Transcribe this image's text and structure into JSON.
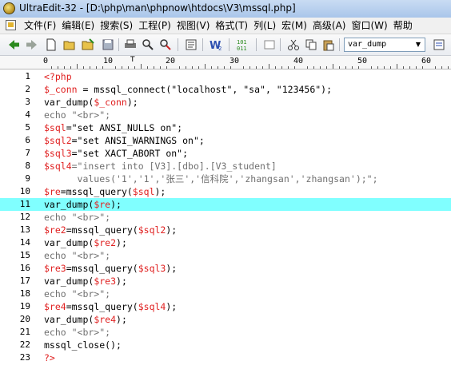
{
  "window": {
    "title": "UltraEdit-32 - [D:\\php\\man\\phpnow\\htdocs\\V3\\mssql.php]"
  },
  "menu": {
    "items": [
      {
        "label": "文件(F)"
      },
      {
        "label": "编辑(E)"
      },
      {
        "label": "搜索(S)"
      },
      {
        "label": "工程(P)"
      },
      {
        "label": "视图(V)"
      },
      {
        "label": "格式(T)"
      },
      {
        "label": "列(L)"
      },
      {
        "label": "宏(M)"
      },
      {
        "label": "高级(A)"
      },
      {
        "label": "窗口(W)"
      },
      {
        "label": "帮助"
      }
    ]
  },
  "toolbar": {
    "icons": [
      "back-arrow-icon",
      "forward-arrow-icon",
      "new-file-icon",
      "open-folder-icon",
      "open-folder-icon",
      "save-icon",
      "print-icon",
      "find-icon",
      "replace-icon",
      "properties-icon",
      "word-icon",
      "hex-icon",
      "cut-icon",
      "copy-icon",
      "paste-icon"
    ],
    "function_combo_value": "var_dump",
    "colors": {
      "back": "#2b8a1e",
      "forward": "#2b8a1e"
    }
  },
  "ruler": {
    "labels": [
      "0",
      "10",
      "20",
      "30",
      "40",
      "50",
      "60"
    ]
  },
  "editor": {
    "current_line": 11,
    "highlight_color": "#80ffff",
    "lines": [
      {
        "num": "1",
        "tokens": [
          {
            "t": "<?php",
            "c": "red"
          }
        ]
      },
      {
        "num": "2",
        "tokens": [
          {
            "t": "$_conn",
            "c": "red"
          },
          {
            "t": " = mssql_connect(\"localhost\", \"sa\", \"123456\");",
            "c": ""
          }
        ]
      },
      {
        "num": "3",
        "tokens": [
          {
            "t": "var_dump(",
            "c": ""
          },
          {
            "t": "$_conn",
            "c": "red"
          },
          {
            "t": ");",
            "c": ""
          }
        ]
      },
      {
        "num": "4",
        "tokens": [
          {
            "t": "echo \"<br>\";",
            "c": "gray"
          }
        ]
      },
      {
        "num": "5",
        "tokens": [
          {
            "t": "$sql",
            "c": "red"
          },
          {
            "t": "=\"set ANSI_NULLS on\";",
            "c": ""
          }
        ]
      },
      {
        "num": "6",
        "tokens": [
          {
            "t": "$sql2",
            "c": "red"
          },
          {
            "t": "=\"set ANSI_WARNINGS on\";",
            "c": ""
          }
        ]
      },
      {
        "num": "7",
        "tokens": [
          {
            "t": "$sql3",
            "c": "red"
          },
          {
            "t": "=\"set XACT_ABORT on\";",
            "c": ""
          }
        ]
      },
      {
        "num": "8",
        "tokens": [
          {
            "t": "$sql4",
            "c": "red"
          },
          {
            "t": "=\"insert into [V3].[dbo].[V3_student]",
            "c": "gray"
          }
        ]
      },
      {
        "num": "9",
        "tokens": [
          {
            "t": "      values('1','1','张三','信科院','zhangsan','zhangsan');\";",
            "c": "gray"
          }
        ]
      },
      {
        "num": "10",
        "tokens": [
          {
            "t": "$re",
            "c": "red"
          },
          {
            "t": "=mssql_query(",
            "c": ""
          },
          {
            "t": "$sql",
            "c": "red"
          },
          {
            "t": ");",
            "c": ""
          }
        ]
      },
      {
        "num": "11",
        "tokens": [
          {
            "t": "var_dump(",
            "c": ""
          },
          {
            "t": "$re",
            "c": "red"
          },
          {
            "t": ");",
            "c": ""
          }
        ]
      },
      {
        "num": "12",
        "tokens": [
          {
            "t": "echo \"<br>\";",
            "c": "gray"
          }
        ]
      },
      {
        "num": "13",
        "tokens": [
          {
            "t": "$re2",
            "c": "red"
          },
          {
            "t": "=mssql_query(",
            "c": ""
          },
          {
            "t": "$sql2",
            "c": "red"
          },
          {
            "t": ");",
            "c": ""
          }
        ]
      },
      {
        "num": "14",
        "tokens": [
          {
            "t": "var_dump(",
            "c": ""
          },
          {
            "t": "$re2",
            "c": "red"
          },
          {
            "t": ");",
            "c": ""
          }
        ]
      },
      {
        "num": "15",
        "tokens": [
          {
            "t": "echo \"<br>\";",
            "c": "gray"
          }
        ]
      },
      {
        "num": "16",
        "tokens": [
          {
            "t": "$re3",
            "c": "red"
          },
          {
            "t": "=mssql_query(",
            "c": ""
          },
          {
            "t": "$sql3",
            "c": "red"
          },
          {
            "t": ");",
            "c": ""
          }
        ]
      },
      {
        "num": "17",
        "tokens": [
          {
            "t": "var_dump(",
            "c": ""
          },
          {
            "t": "$re3",
            "c": "red"
          },
          {
            "t": ");",
            "c": ""
          }
        ]
      },
      {
        "num": "18",
        "tokens": [
          {
            "t": "echo \"<br>\";",
            "c": "gray"
          }
        ]
      },
      {
        "num": "19",
        "tokens": [
          {
            "t": "$re4",
            "c": "red"
          },
          {
            "t": "=mssql_query(",
            "c": ""
          },
          {
            "t": "$sql4",
            "c": "red"
          },
          {
            "t": ");",
            "c": ""
          }
        ]
      },
      {
        "num": "20",
        "tokens": [
          {
            "t": "var_dump(",
            "c": ""
          },
          {
            "t": "$re4",
            "c": "red"
          },
          {
            "t": ");",
            "c": ""
          }
        ]
      },
      {
        "num": "21",
        "tokens": [
          {
            "t": "echo \"<br>\";",
            "c": "gray"
          }
        ]
      },
      {
        "num": "22",
        "tokens": [
          {
            "t": "mssql_close();",
            "c": ""
          }
        ]
      },
      {
        "num": "23",
        "tokens": [
          {
            "t": "?>",
            "c": "red"
          }
        ]
      }
    ]
  }
}
